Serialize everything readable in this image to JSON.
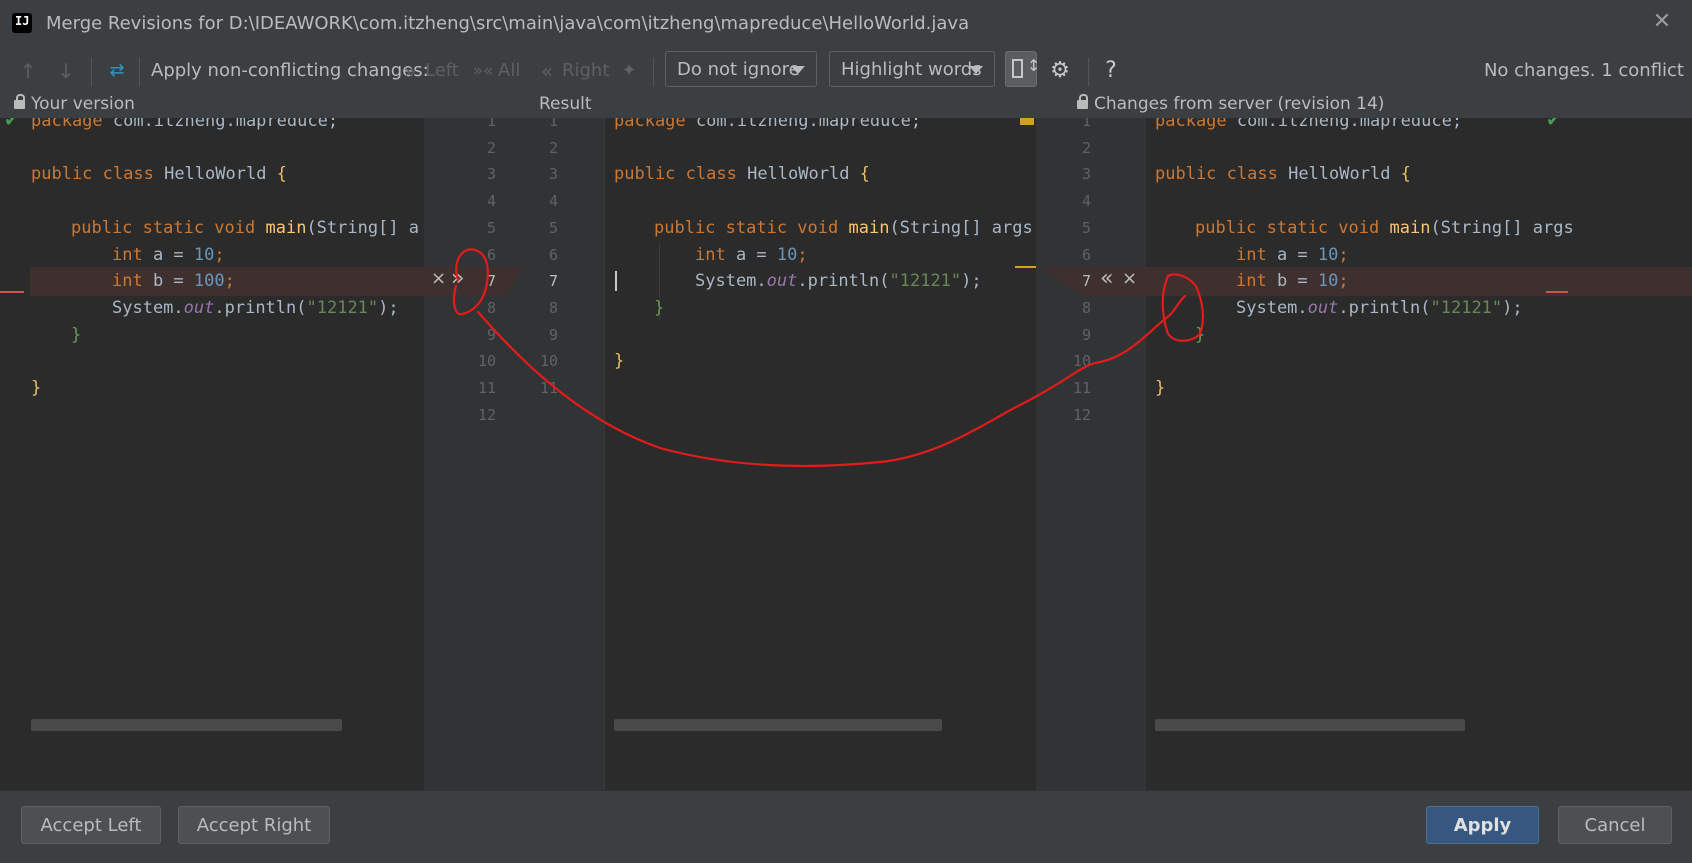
{
  "window": {
    "title": "Merge Revisions for D:\\IDEAWORK\\com.itzheng\\src\\main\\java\\com\\itzheng\\mapreduce\\HelloWorld.java",
    "app_icon_text": "IJ"
  },
  "toolbar": {
    "apply_label": "Apply non-conflicting changes:",
    "left_label": "Left",
    "all_label": "All",
    "right_label": "Right",
    "ignore_select": "Do not ignore",
    "highlight_select": "Highlight words",
    "status": "No changes. 1 conflict",
    "help": "?"
  },
  "panels": {
    "left_header": "Your version",
    "center_header": "Result",
    "right_header": "Changes from server (revision 14)"
  },
  "gutter": {
    "left_numbers": [
      "1",
      "2",
      "3",
      "4",
      "5",
      "6",
      "7",
      "8",
      "9",
      "10",
      "11",
      "12"
    ],
    "result_numbers": [
      "1",
      "2",
      "3",
      "4",
      "5",
      "6",
      "7",
      "8",
      "9",
      "10",
      "11"
    ],
    "right_numbers": [
      "1",
      "2",
      "3",
      "4",
      "5",
      "6",
      "7",
      "8",
      "9",
      "10",
      "11",
      "12"
    ]
  },
  "code": {
    "package": "package",
    "pkg_name": " com.itzheng.mapreduce;",
    "public": "public",
    "class": " class",
    "class_name": " HelloWorld ",
    "open_brace": "{",
    "static_void": " static void ",
    "main": "main",
    "main_args_left": "(String[] a",
    "main_args": "(String[] args)",
    "main_args_right": "(String[] args",
    "int": "int",
    "var_a": " a = ",
    "val_10": "10",
    "semicolon": ";",
    "var_b": " b = ",
    "val_100": "100",
    "system": "System.",
    "out": "out",
    "println": ".println(",
    "str_12121": "\"12121\"",
    "close_paren": ");",
    "close_brace": "}"
  },
  "markers": {
    "reject": "×",
    "apply_left": "»",
    "apply_right": "«"
  },
  "buttons": {
    "accept_left": "Accept Left",
    "accept_right": "Accept Right",
    "apply": "Apply",
    "cancel": "Cancel"
  },
  "colors": {
    "conflict_band": "#3f3030",
    "annotation": "#e31b1b",
    "primary_button": "#365880"
  }
}
